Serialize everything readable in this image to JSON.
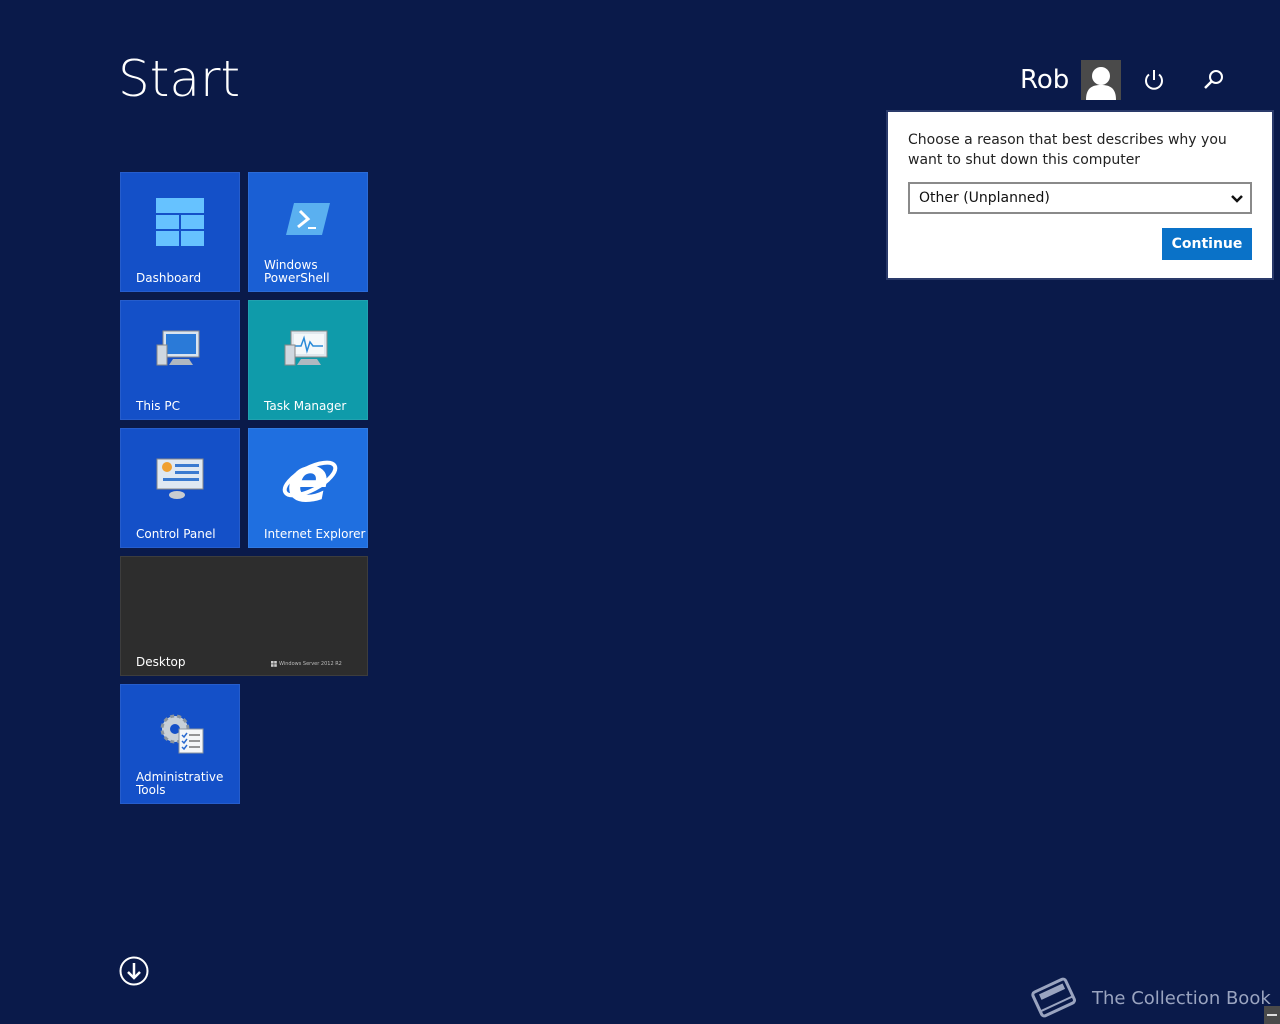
{
  "header": {
    "title": "Start",
    "user_name": "Rob"
  },
  "icons": {
    "power": "power-icon",
    "search": "search-icon",
    "avatar": "user-avatar-icon",
    "scroll_down": "arrow-down-circle-icon"
  },
  "tiles": [
    {
      "label": "Dashboard",
      "color": "#1450c8"
    },
    {
      "label": "Windows\nPowerShell",
      "color": "#1a5fd4"
    },
    {
      "label": "This PC",
      "color": "#1450c8"
    },
    {
      "label": "Task Manager",
      "color": "#0f9baa"
    },
    {
      "label": "Control Panel",
      "color": "#1450c8"
    },
    {
      "label": "Internet Explorer",
      "color": "#1f6fe0"
    },
    {
      "label": "Desktop",
      "color": "#2d2d2d",
      "badge": "Windows Server 2012 R2"
    },
    {
      "label": "Administrative\nTools",
      "color": "#1450c8"
    }
  ],
  "dialog": {
    "prompt": "Choose a reason that best describes why you want to shut down this computer",
    "selected_reason": "Other (Unplanned)",
    "continue_label": "Continue",
    "accent": "#0a72c8"
  },
  "watermark": {
    "text": "The Collection Book"
  }
}
